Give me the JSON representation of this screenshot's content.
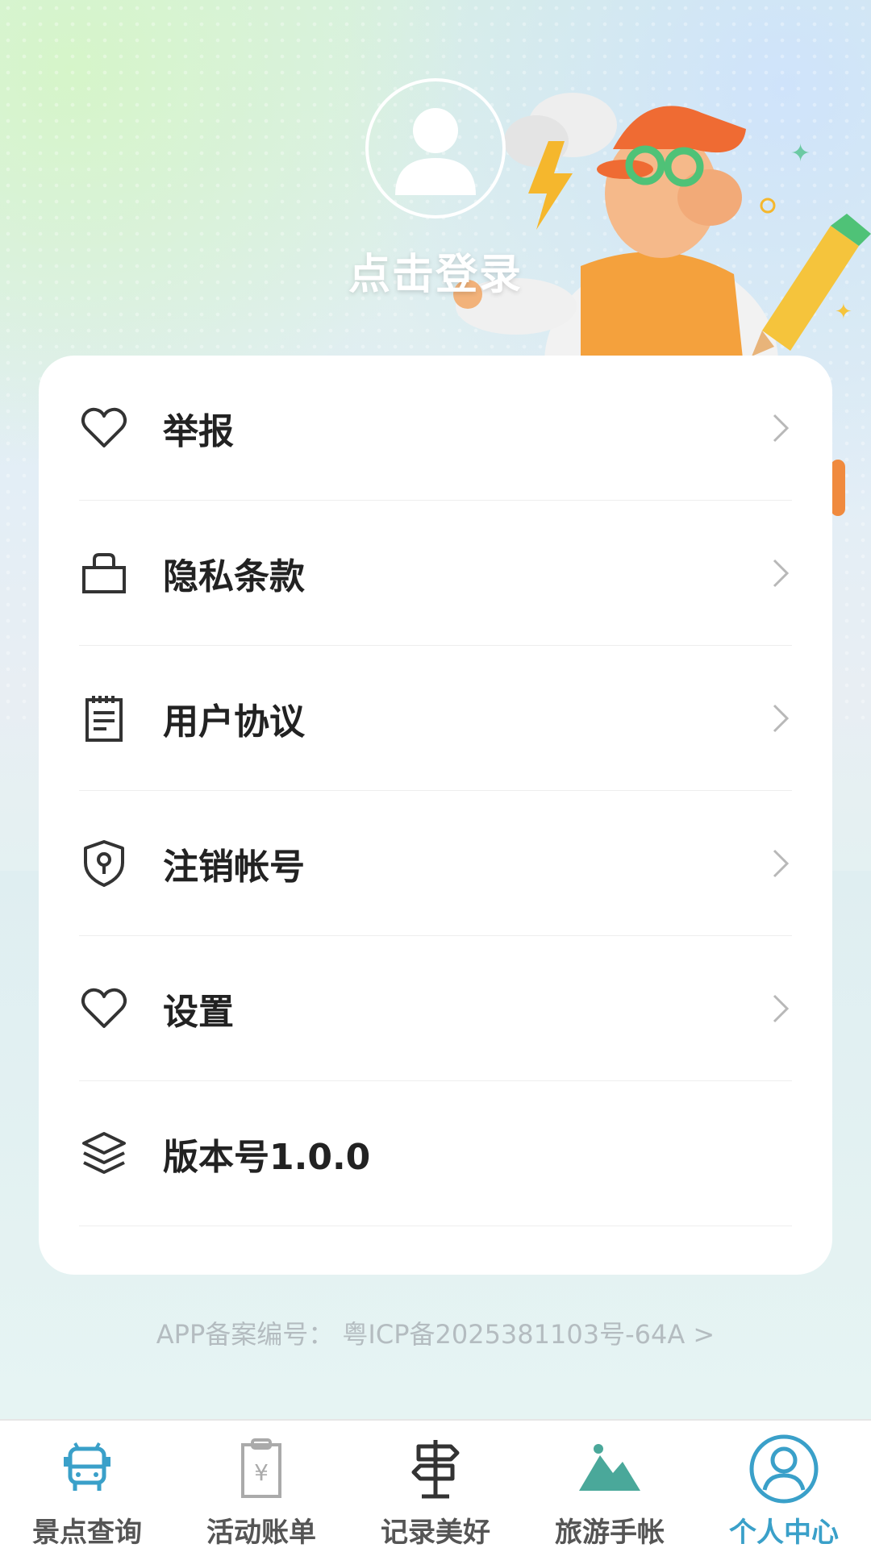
{
  "header": {
    "login_text": "点击登录"
  },
  "menu": {
    "items": [
      {
        "label": "举报",
        "icon": "heart-icon",
        "has_chevron": true
      },
      {
        "label": "隐私条款",
        "icon": "bag-icon",
        "has_chevron": true
      },
      {
        "label": "用户协议",
        "icon": "clipboard-icon",
        "has_chevron": true
      },
      {
        "label": "注销帐号",
        "icon": "shield-icon",
        "has_chevron": true
      },
      {
        "label": "设置",
        "icon": "heart-icon",
        "has_chevron": true
      },
      {
        "label": "版本号1.0.0",
        "icon": "layers-icon",
        "has_chevron": false
      }
    ]
  },
  "footer": {
    "icp_text": "APP备案编号：  粤ICP备2025381103号-64A  >"
  },
  "tabbar": {
    "tabs": [
      {
        "label": "景点查询",
        "icon": "bus-icon",
        "active": false
      },
      {
        "label": "活动账单",
        "icon": "bill-icon",
        "active": false
      },
      {
        "label": "记录美好",
        "icon": "signpost-icon",
        "active": false
      },
      {
        "label": "旅游手帐",
        "icon": "mountain-icon",
        "active": false
      },
      {
        "label": "个人中心",
        "icon": "user-circle-icon",
        "active": true
      }
    ]
  },
  "colors": {
    "accent": "#3aa0c9",
    "teal": "#4aa89a",
    "text": "#222222",
    "muted": "#b4bcc0"
  }
}
